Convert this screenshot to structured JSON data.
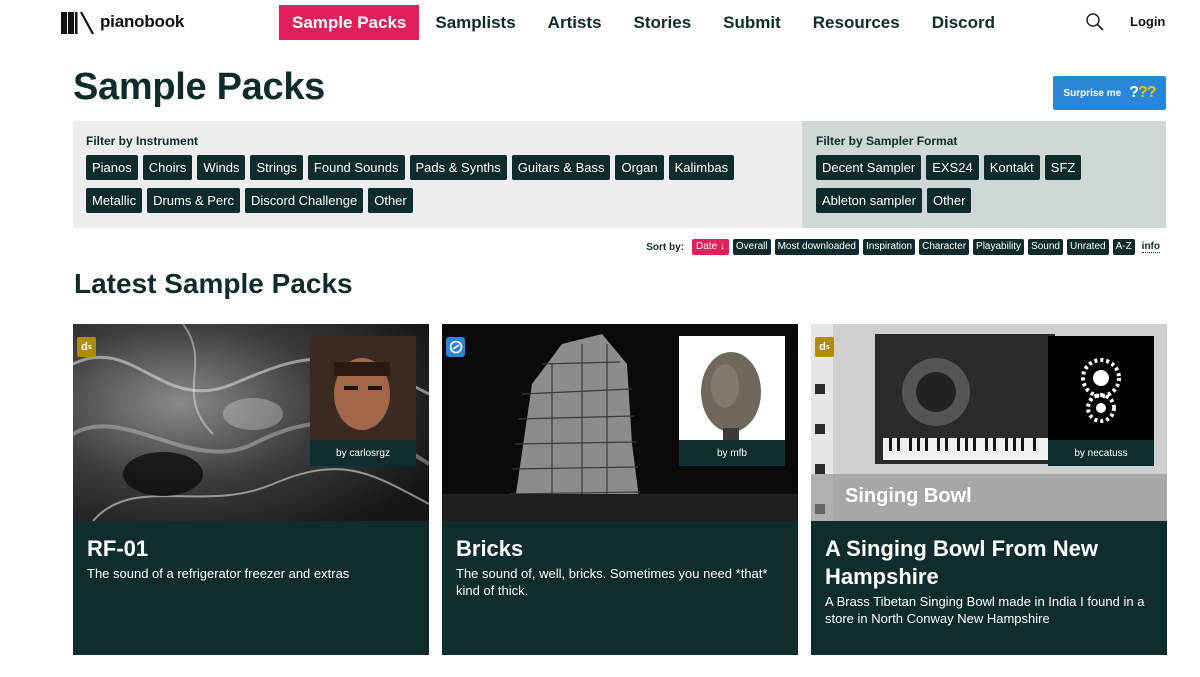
{
  "brand": {
    "name": "pianobook"
  },
  "nav": {
    "items": [
      {
        "label": "Sample Packs",
        "active": true
      },
      {
        "label": "Samplists"
      },
      {
        "label": "Artists"
      },
      {
        "label": "Stories"
      },
      {
        "label": "Submit"
      },
      {
        "label": "Resources"
      },
      {
        "label": "Discord"
      }
    ],
    "search_icon": "search-icon",
    "login": "Login"
  },
  "page": {
    "title": "Sample Packs",
    "surprise_button": {
      "label": "Surprise me",
      "glyph": "???"
    }
  },
  "filters": {
    "instrument": {
      "title": "Filter by Instrument",
      "chips": [
        "Pianos",
        "Choirs",
        "Winds",
        "Strings",
        "Found Sounds",
        "Pads & Synths",
        "Guitars & Bass",
        "Organ",
        "Kalimbas",
        "Metallic",
        "Drums & Perc",
        "Discord Challenge",
        "Other"
      ]
    },
    "format": {
      "title": "Filter by Sampler Format",
      "chips": [
        "Decent Sampler",
        "EXS24",
        "Kontakt",
        "SFZ",
        "Ableton sampler",
        "Other"
      ]
    }
  },
  "sort": {
    "label": "Sort by:",
    "options": [
      "Date ↓",
      "Overall",
      "Most downloaded",
      "Inspiration",
      "Character",
      "Playability",
      "Sound",
      "Unrated",
      "A-Z"
    ],
    "active_index": 0,
    "info": "info"
  },
  "section": {
    "title": "Latest Sample Packs"
  },
  "cards": [
    {
      "title": "RF-01",
      "description": "The sound of a refrigerator freezer and extras",
      "author": "by carlosrgz",
      "badge": "ds",
      "image_text": ""
    },
    {
      "title": "Bricks",
      "description": "The sound of, well, bricks. Sometimes you need *that* kind of thick.",
      "author": "by mfb",
      "badge": "machine",
      "image_text": ""
    },
    {
      "title": "A Singing Bowl From New Hampshire",
      "description": "A Brass Tibetan Singing Bowl made in India I found in a store in North Conway New Hampshire",
      "author": "by necatuss",
      "badge": "ds",
      "image_text": "Singing Bowl"
    }
  ],
  "colors": {
    "accent": "#e0205a",
    "dark": "#0f2b2b",
    "button_blue": "#2a86d6",
    "filter_bg": "#ededed",
    "format_bg": "#cfd8d5"
  }
}
